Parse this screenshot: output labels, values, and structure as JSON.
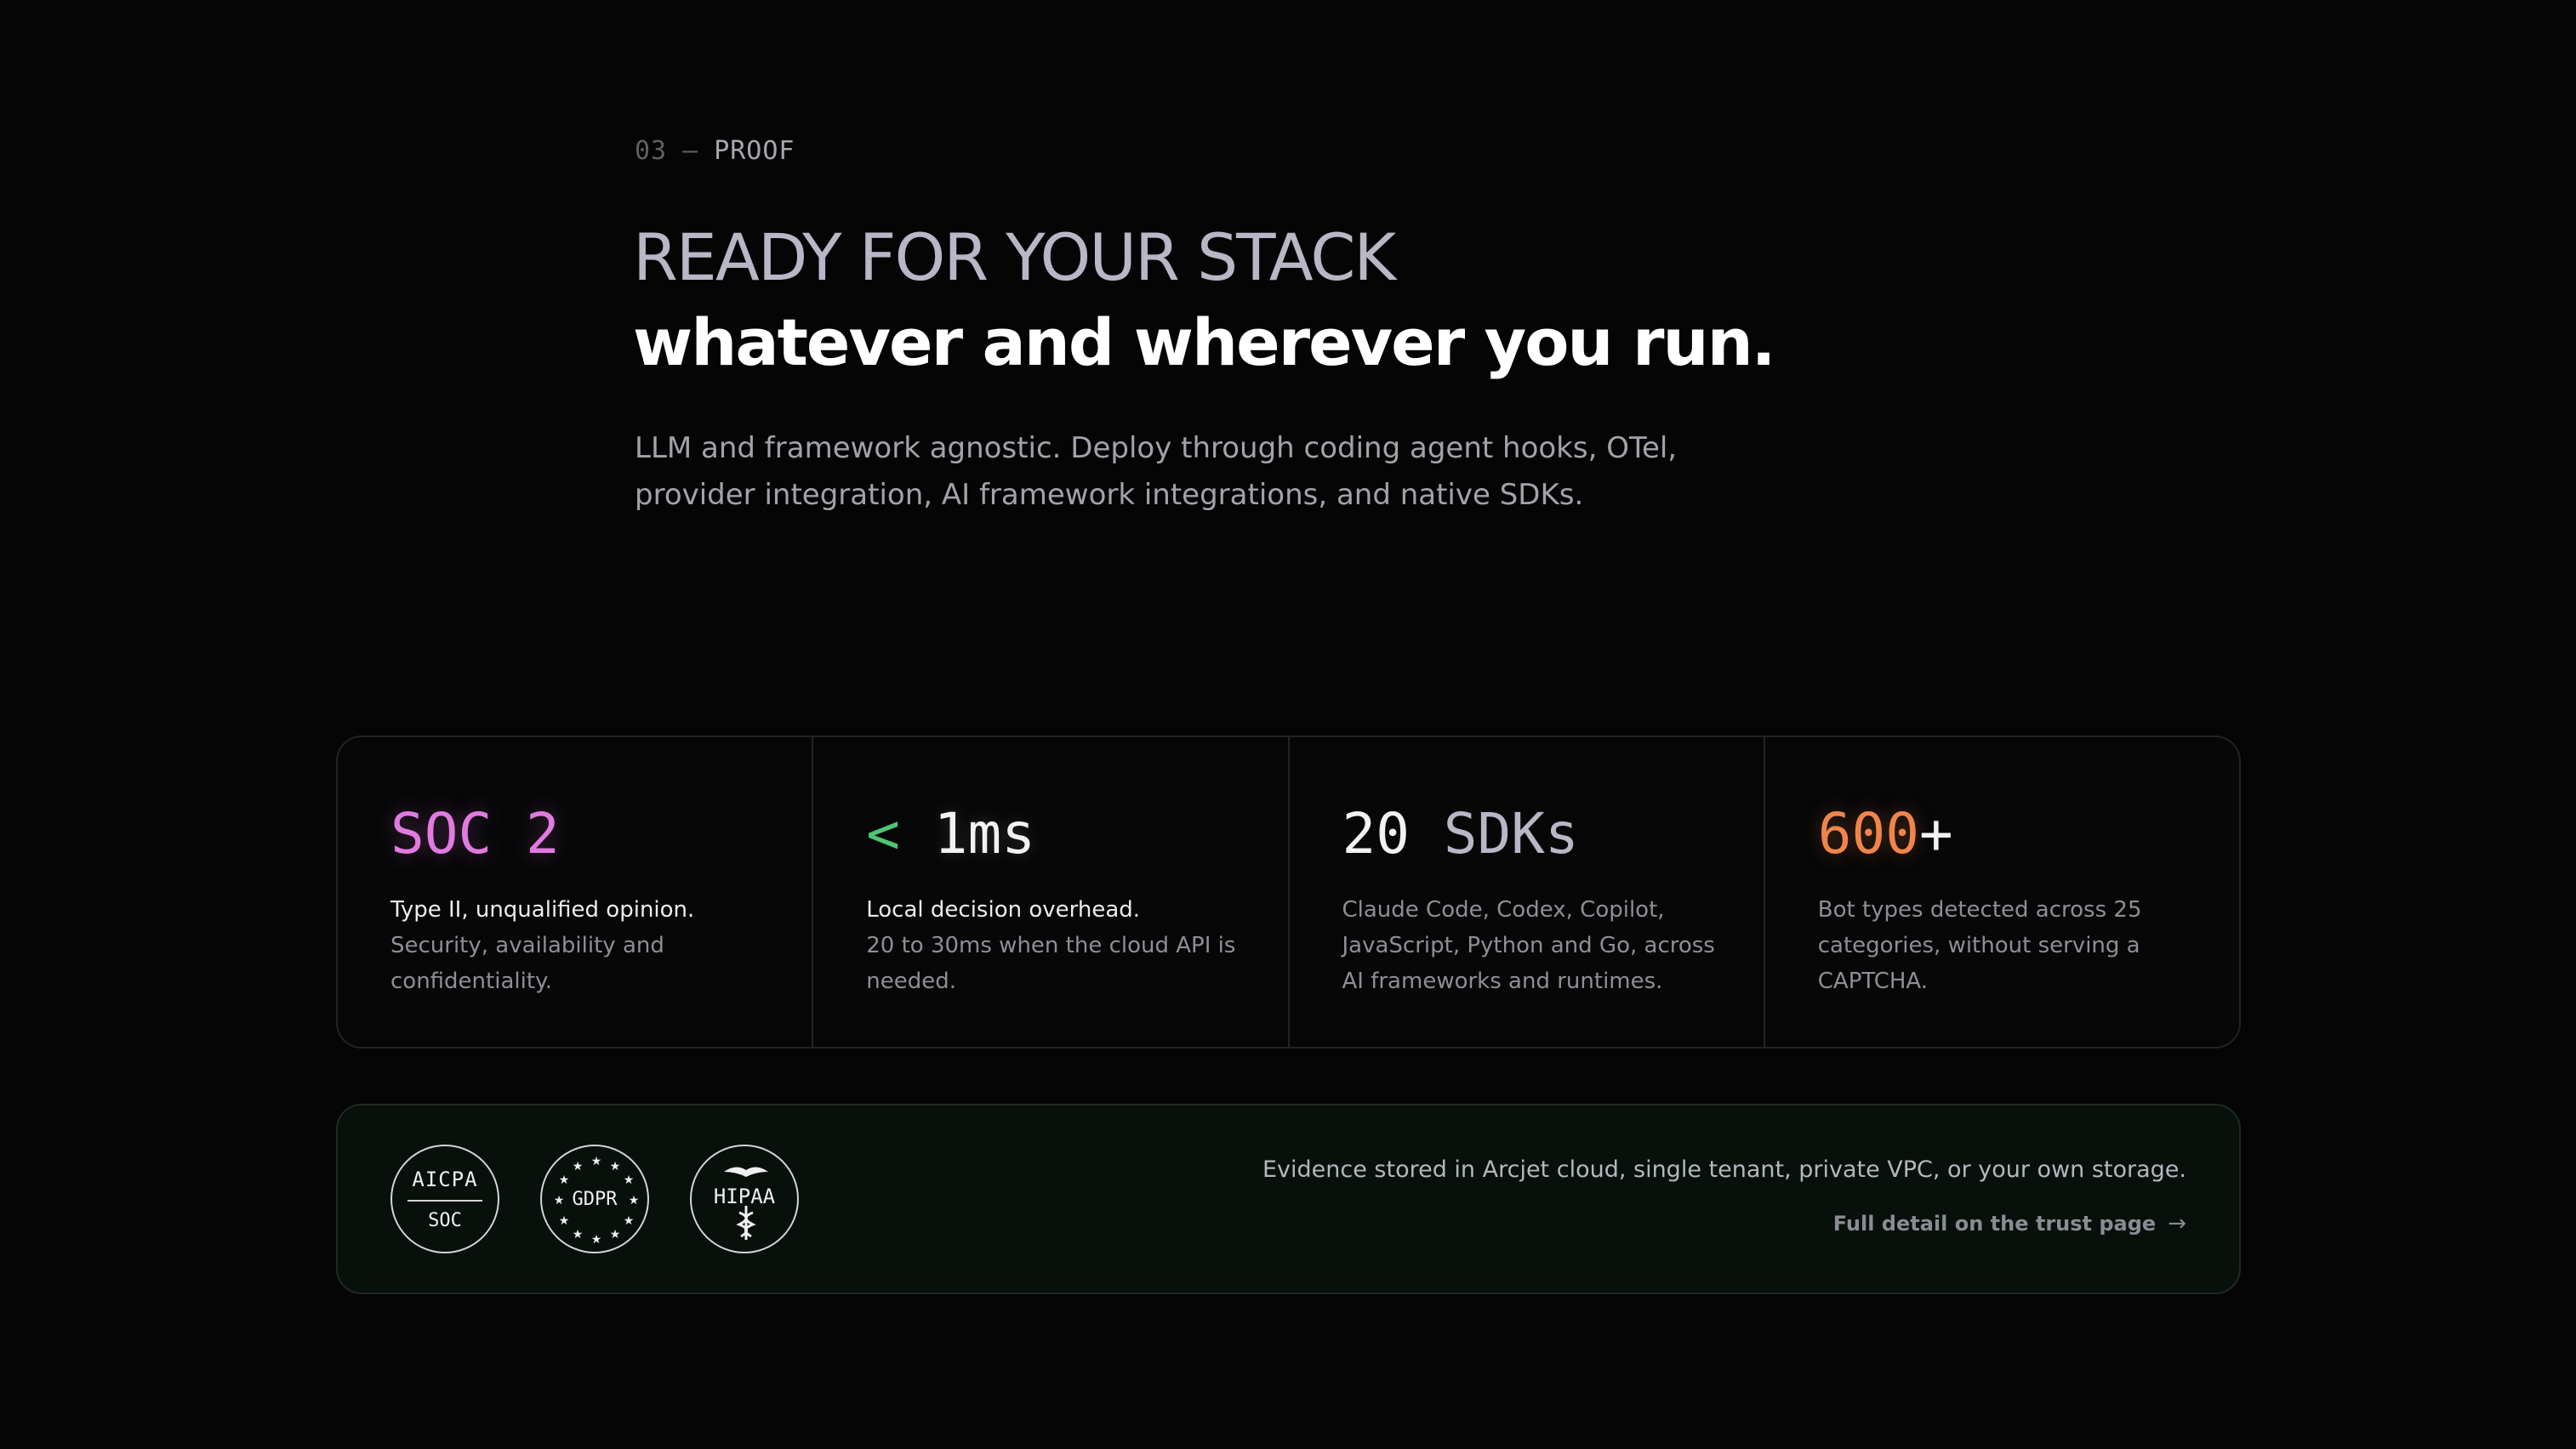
{
  "hero": {
    "eyebrow_num": "03",
    "eyebrow_dash": "–",
    "eyebrow_label": "PROOF",
    "title_line1": "READY FOR YOUR STACK",
    "title_line2": "whatever and wherever you run.",
    "lede": "LLM and framework agnostic. Deploy through coding agent hooks, OTel, provider integration, AI framework integrations, and native SDKs."
  },
  "stats": [
    {
      "value_a": "SOC 2",
      "lead": "Type II, unqualified opinion.",
      "desc": "Security, availability and confidentiality."
    },
    {
      "value_a": "<",
      "value_b": "1ms",
      "lead": "Local decision overhead.",
      "desc": "20 to 30ms when the cloud API is needed."
    },
    {
      "value_a": "20",
      "value_b": "SDKs",
      "desc": "Claude Code, Codex, Copilot, JavaScript, Python and Go, across AI frameworks and runtimes."
    },
    {
      "value_a": "600",
      "value_b": "+",
      "desc": "Bot types detected across 25 categories, without serving a CAPTCHA."
    }
  ],
  "trust": {
    "badges": [
      {
        "top": "AICPA",
        "bottom": "SOC",
        "icon": "aicpa-soc-badge-icon"
      },
      {
        "label": "GDPR",
        "icon": "gdpr-stars-badge-icon"
      },
      {
        "label": "HIPAA",
        "icon": "hipaa-caduceus-badge-icon"
      }
    ],
    "text": "Evidence stored in Arcjet cloud, single tenant, private VPC, or your own storage.",
    "link_label": "Full detail on the trust page",
    "link_icon": "arrow-right-icon"
  },
  "colors": {
    "background": "#050506",
    "soc": "#e17be0",
    "less_than": "#4ec474",
    "bots": "#f0854b"
  }
}
